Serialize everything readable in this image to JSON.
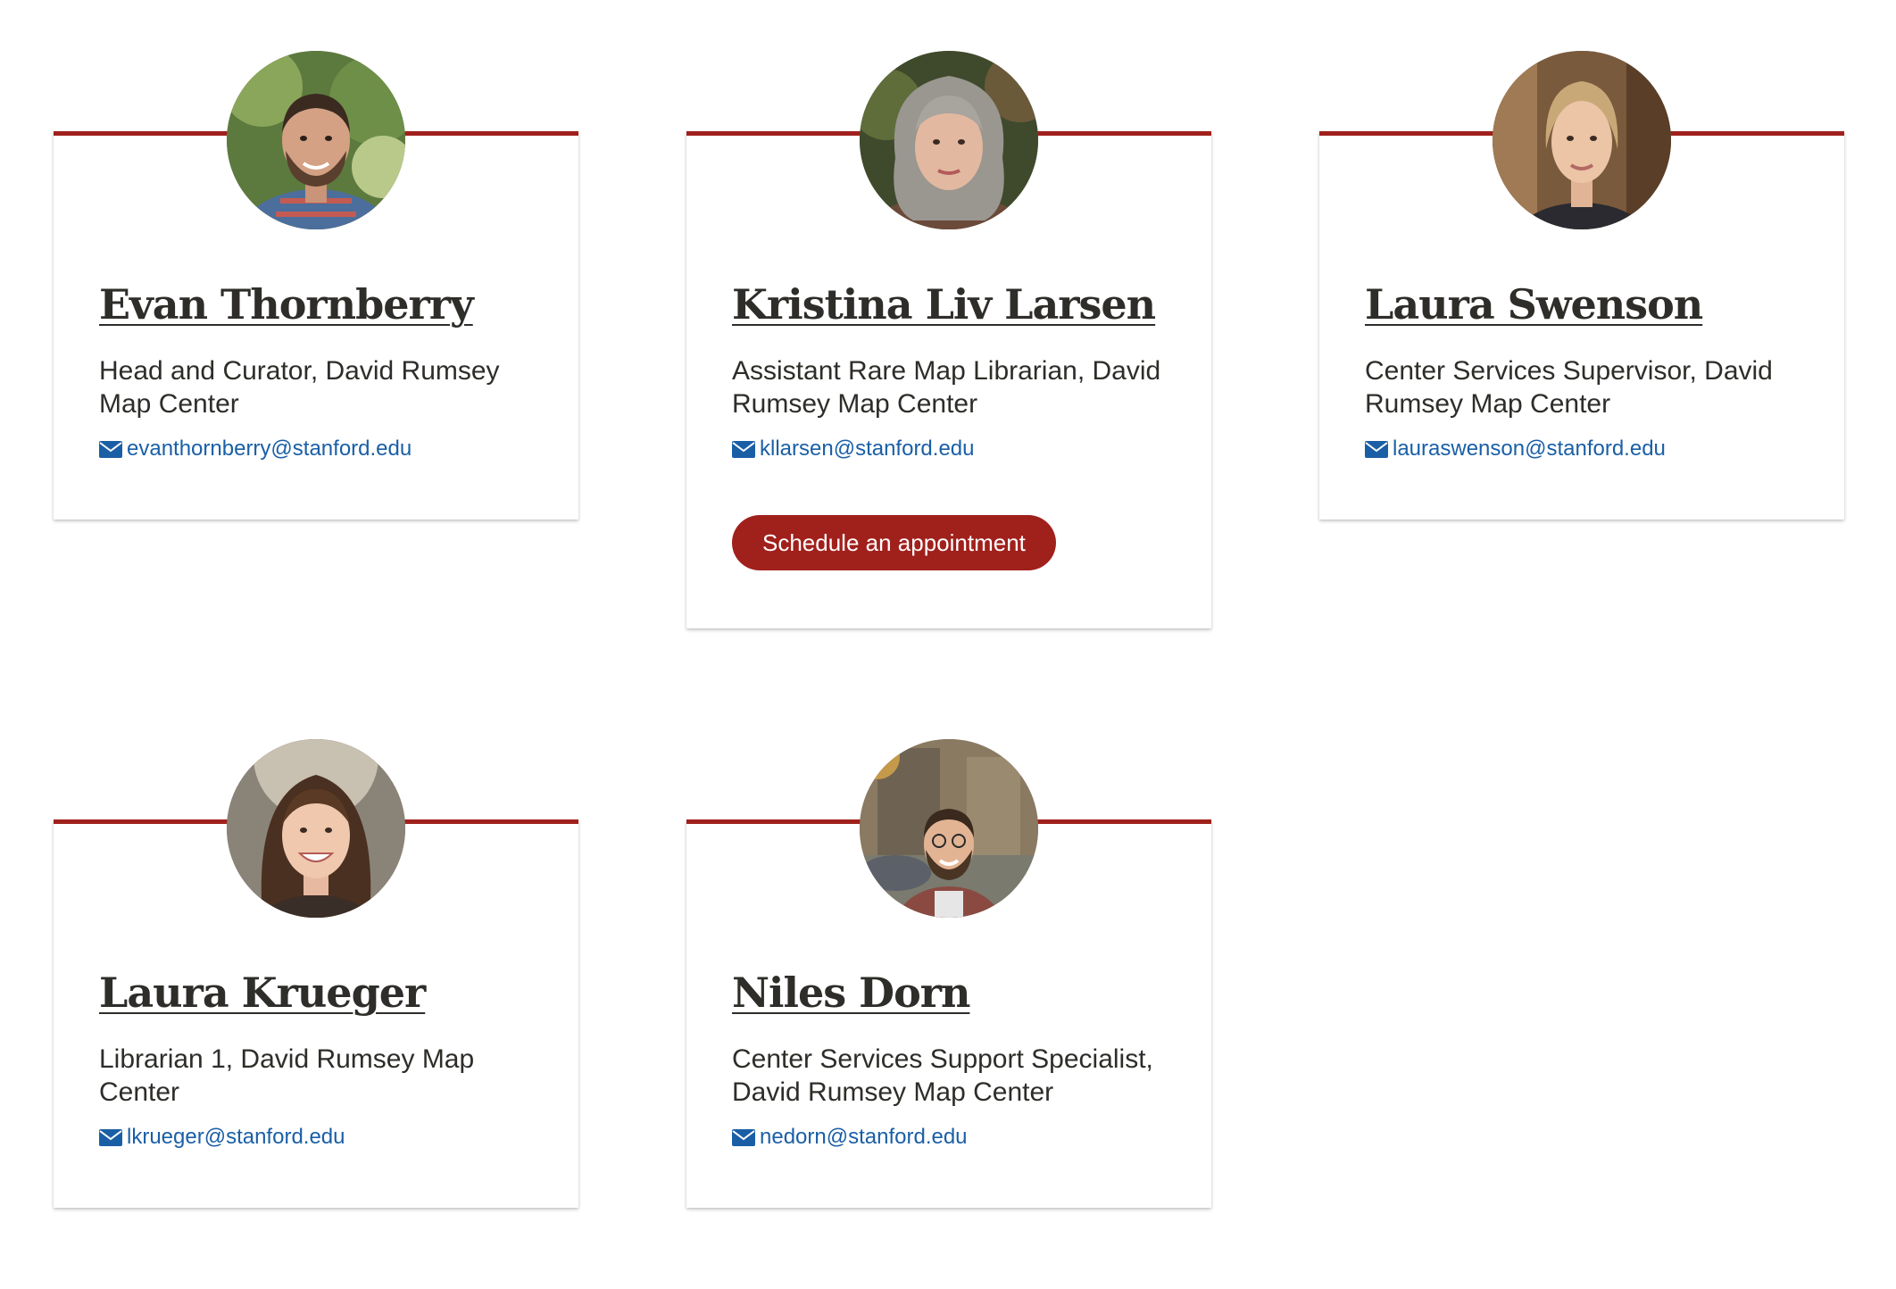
{
  "colors": {
    "accent": "#a0201c",
    "link": "#1a5fa6",
    "text": "#2e2d29"
  },
  "icons": {
    "email": "envelope-icon"
  },
  "staff": [
    {
      "name": "Evan Thornberry",
      "role": "Head and Curator, David Rumsey Map Center",
      "email": "evanthornberry@stanford.edu"
    },
    {
      "name": "Kristina Liv Larsen",
      "role": "Assistant Rare Map Librarian, David Rumsey Map Center",
      "email": "kllarsen@stanford.edu",
      "button": "Schedule an appointment"
    },
    {
      "name": "Laura Swenson",
      "role": "Center Services Supervisor, David Rumsey Map Center",
      "email": "lauraswenson@stanford.edu"
    },
    {
      "name": "Laura Krueger",
      "role": "Librarian 1, David Rumsey Map Center",
      "email": "lkrueger@stanford.edu"
    },
    {
      "name": "Niles Dorn",
      "role": "Center Services Support Specialist, David Rumsey Map Center",
      "email": "nedorn@stanford.edu"
    }
  ]
}
